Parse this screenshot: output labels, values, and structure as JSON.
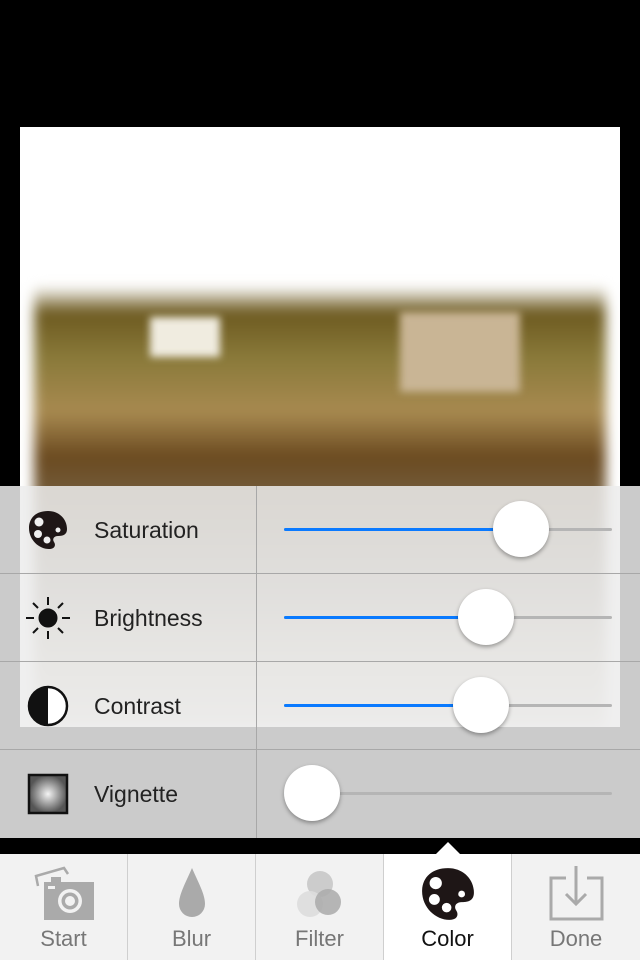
{
  "adjustments": [
    {
      "label": "Saturation",
      "icon": "palette-icon",
      "value": 0.77
    },
    {
      "label": "Brightness",
      "icon": "sun-icon",
      "value": 0.64
    },
    {
      "label": "Contrast",
      "icon": "contrast-icon",
      "value": 0.62
    },
    {
      "label": "Vignette",
      "icon": "vignette-icon",
      "value": 0.0
    }
  ],
  "tabs": [
    {
      "label": "Start",
      "icon": "camera-photo-icon"
    },
    {
      "label": "Blur",
      "icon": "drop-icon"
    },
    {
      "label": "Filter",
      "icon": "circles-icon"
    },
    {
      "label": "Color",
      "icon": "palette-icon",
      "active": true
    },
    {
      "label": "Done",
      "icon": "download-icon"
    }
  ],
  "colors": {
    "accent": "#0a7aff",
    "active_tab": "#ffffff",
    "inactive_icon": "#b0b0b0"
  }
}
